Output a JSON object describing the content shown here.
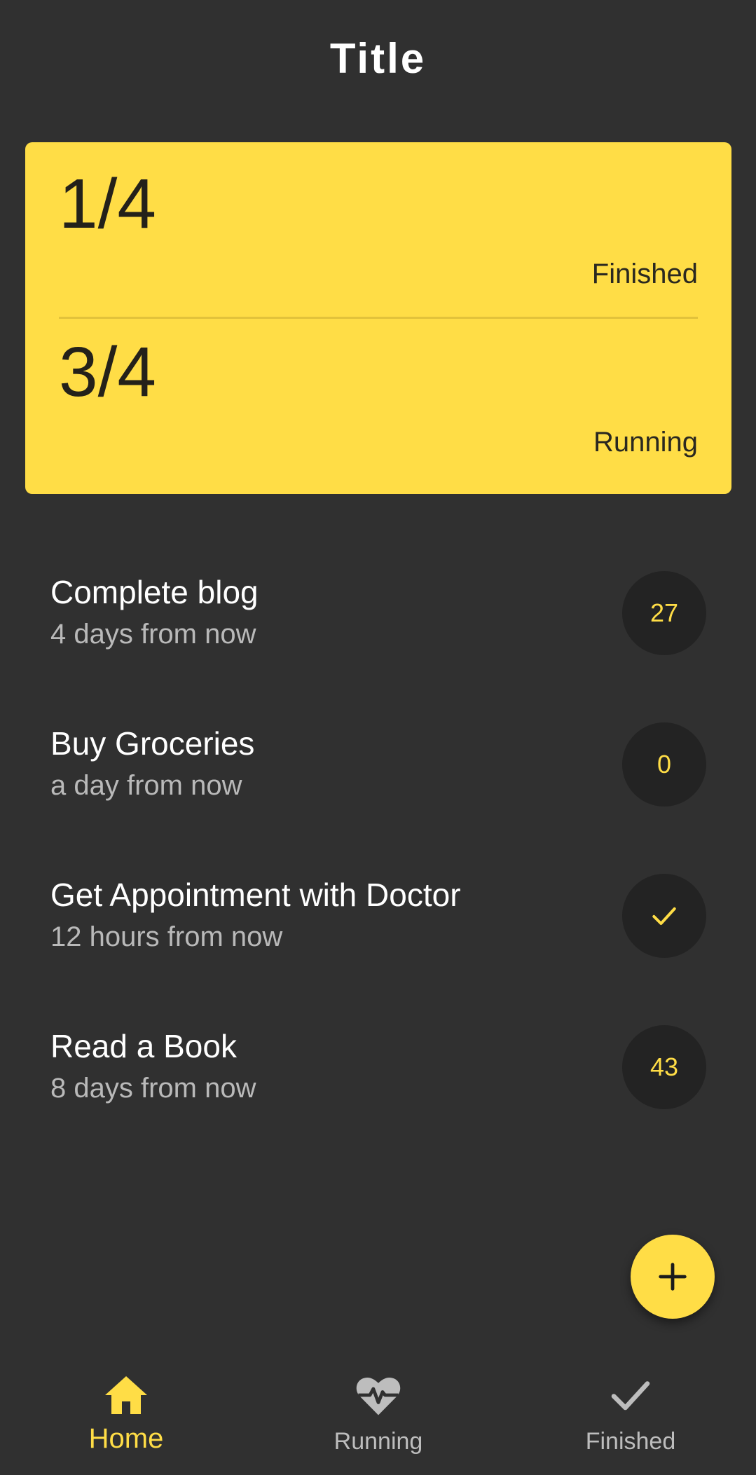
{
  "header": {
    "title": "Title"
  },
  "summary": {
    "finished": {
      "value": "1/4",
      "label": "Finished"
    },
    "running": {
      "value": "3/4",
      "label": "Running"
    }
  },
  "tasks": [
    {
      "title": "Complete blog",
      "due": "4 days from now",
      "badge": "27",
      "badge_type": "count"
    },
    {
      "title": "Buy Groceries",
      "due": "a day from now",
      "badge": "0",
      "badge_type": "count"
    },
    {
      "title": "Get Appointment with Doctor",
      "due": "12 hours from now",
      "badge": "",
      "badge_type": "check-icon"
    },
    {
      "title": "Read a Book",
      "due": "8 days from now",
      "badge": "43",
      "badge_type": "count"
    }
  ],
  "fab": {
    "icon": "plus-icon"
  },
  "bottom_nav": {
    "items": [
      {
        "label": "Home",
        "icon": "home-icon",
        "active": true
      },
      {
        "label": "Running",
        "icon": "heartbeat-icon",
        "active": false
      },
      {
        "label": "Finished",
        "icon": "check-icon",
        "active": false
      }
    ]
  },
  "colors": {
    "background": "#303030",
    "accent": "#ffdd46",
    "badge_background": "#232323",
    "text_primary": "#ffffff",
    "text_secondary": "#b9b9b9",
    "nav_inactive": "#bdbdbd"
  }
}
